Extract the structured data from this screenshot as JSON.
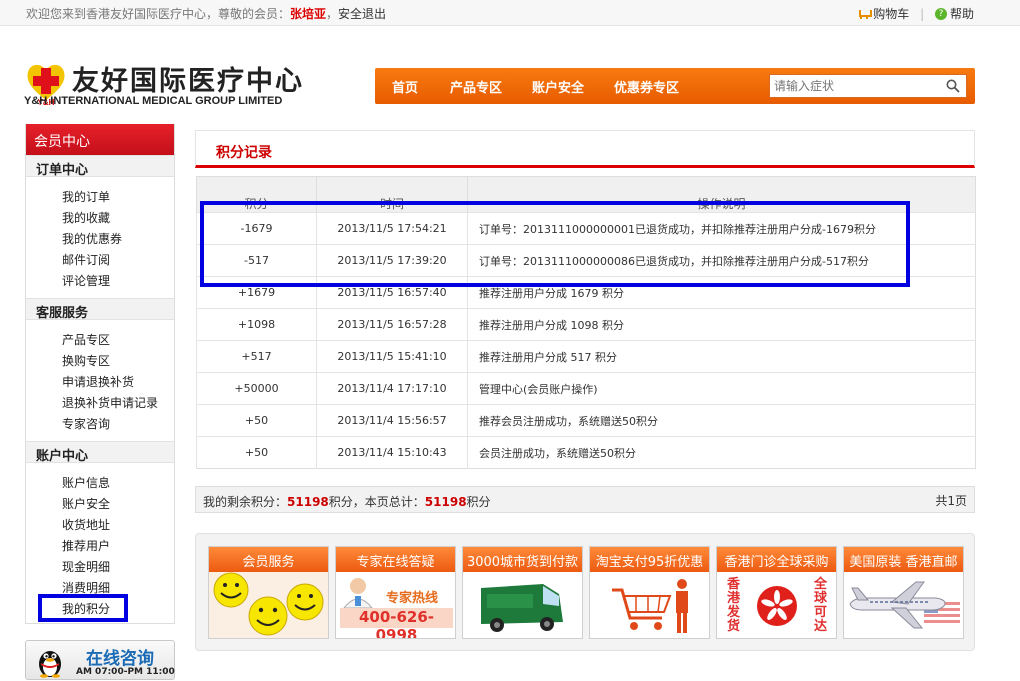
{
  "topbar": {
    "welcome_prefix": "欢迎您来到香港友好国际医疗中心，尊敬的会员：",
    "username": "张培亚",
    "separator": "，",
    "logout": "安全退出",
    "cart": "购物车",
    "help": "帮助",
    "divider": "|"
  },
  "logo": {
    "cn": "友好国际医疗中心",
    "en": "Y&H INTERNATIONAL MEDICAL GROUP LIMITED",
    "mark_text": "Y&H"
  },
  "nav": {
    "items": [
      "首页",
      "产品专区",
      "账户安全",
      "优惠券专区"
    ],
    "search_placeholder": "请输入症状"
  },
  "sidebar": {
    "title": "会员中心",
    "groups": [
      {
        "title": "订单中心",
        "items": [
          "我的订单",
          "我的收藏",
          "我的优惠券",
          "邮件订阅",
          "评论管理"
        ]
      },
      {
        "title": "客服服务",
        "items": [
          "产品专区",
          "换购专区",
          "申请退换补货",
          "退换补货申请记录",
          "专家咨询"
        ]
      },
      {
        "title": "账户中心",
        "items": [
          "账户信息",
          "账户安全",
          "收货地址",
          "推荐用户",
          "现金明细",
          "消费明细",
          "我的积分"
        ]
      }
    ],
    "chat": {
      "title": "在线咨询",
      "hours": "AM 07:00-PM 11:00"
    }
  },
  "main": {
    "title": "积分记录",
    "table": {
      "headers": [
        "积分",
        "时间",
        "操作说明"
      ],
      "rows": [
        {
          "points": "-1679",
          "time": "2013/11/5 17:54:21",
          "desc": "订单号：2013111000000001已退货成功，并扣除推荐注册用户分成-1679积分"
        },
        {
          "points": "-517",
          "time": "2013/11/5 17:39:20",
          "desc": "订单号：2013111000000086已退货成功，并扣除推荐注册用户分成-517积分"
        },
        {
          "points": "+1679",
          "time": "2013/11/5 16:57:40",
          "desc": "推荐注册用户分成 1679 积分"
        },
        {
          "points": "+1098",
          "time": "2013/11/5 16:57:28",
          "desc": "推荐注册用户分成 1098 积分"
        },
        {
          "points": "+517",
          "time": "2013/11/5 15:41:10",
          "desc": "推荐注册用户分成 517 积分"
        },
        {
          "points": "+50000",
          "time": "2013/11/4 17:17:10",
          "desc": "管理中心(会员账户操作)"
        },
        {
          "points": "+50",
          "time": "2013/11/4 15:56:57",
          "desc": "推荐会员注册成功，系统赠送50积分"
        },
        {
          "points": "+50",
          "time": "2013/11/4 15:10:43",
          "desc": "会员注册成功，系统赠送50积分"
        }
      ]
    },
    "summary": {
      "remaining_label": "我的剩余积分：",
      "remaining_value": "51198",
      "unit": "积分",
      "page_total_label": "，本页总计：",
      "page_total_value": "51198",
      "pages": "共1页"
    },
    "promos": [
      {
        "caption": "会员服务"
      },
      {
        "caption": "专家在线答疑",
        "hotline": "专家热线",
        "phone": "400-626-0998"
      },
      {
        "caption": "3000城市货到付款"
      },
      {
        "caption": "淘宝支付95折优惠"
      },
      {
        "caption": "香港门诊全球采购",
        "left_text": "香港发货",
        "right_text": "全球可达"
      },
      {
        "caption": "美国原装 香港直邮"
      }
    ]
  },
  "colors": {
    "nav_orange": "#f06c10",
    "brand_red": "#d00000",
    "highlight_blue": "#0000e0"
  }
}
